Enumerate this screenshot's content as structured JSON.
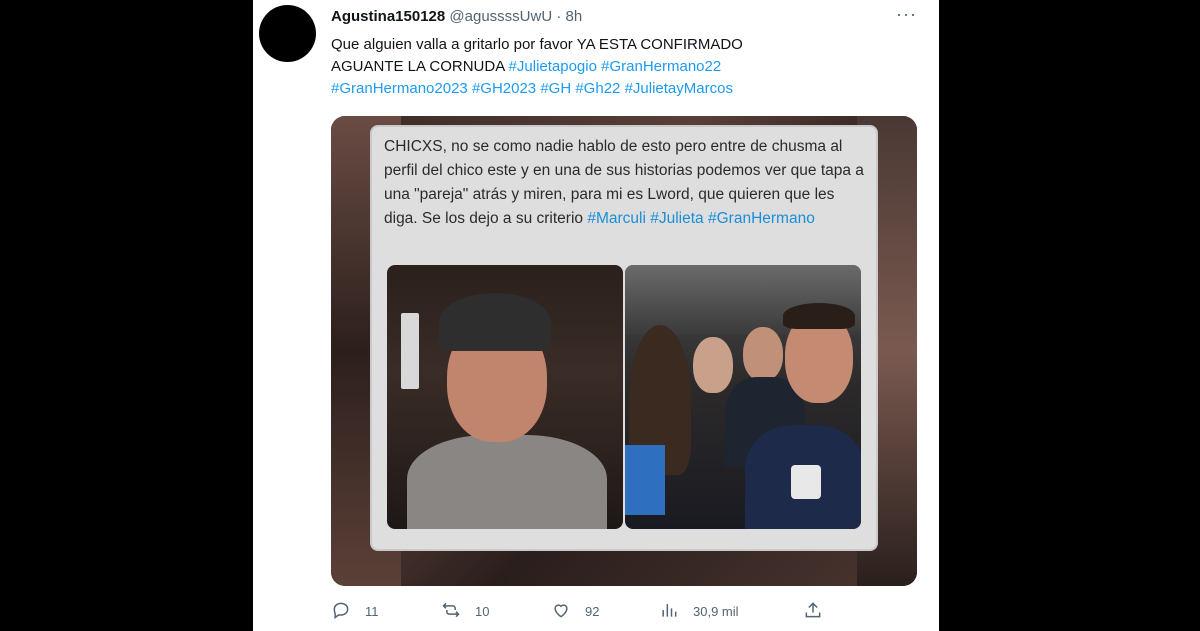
{
  "tweet": {
    "author_name": "Agustina150128",
    "handle": "@agussssUwU",
    "separator": "·",
    "time": "8h",
    "more_label": "···",
    "text_line1": "Que alguien valla a gritarlo por favor YA ESTA CONFIRMADO",
    "text_line2_plain": "AGUANTE LA CORNUDA ",
    "hashtags_line2": [
      "#Julietapogio",
      "#GranHermano22"
    ],
    "hashtags_line3": [
      "#GranHermano2023",
      "#GH2023",
      "#GH",
      "#Gh22",
      "#JulietayMarcos"
    ]
  },
  "media": {
    "card_text": "CHICXS, no se como nadie hablo de esto pero entre de chusma al perfil del chico este y en una de sus historias podemos ver que tapa a una \"pareja\" atrás y miren, para mi es Lword, que quieren que les diga. Se los dejo a su criterio ",
    "card_hashtags": [
      "#Marculi",
      "#Julieta",
      "#GranHermano"
    ]
  },
  "actions": {
    "replies": "11",
    "retweets": "10",
    "likes": "92",
    "views": "30,9 mil"
  },
  "icons": {
    "reply": "reply-icon",
    "retweet": "retweet-icon",
    "like": "heart-icon",
    "views": "views-icon",
    "share": "share-icon",
    "more": "more-icon"
  },
  "colors": {
    "link": "#1d9bf0",
    "muted": "#536471",
    "text": "#0f1419"
  }
}
